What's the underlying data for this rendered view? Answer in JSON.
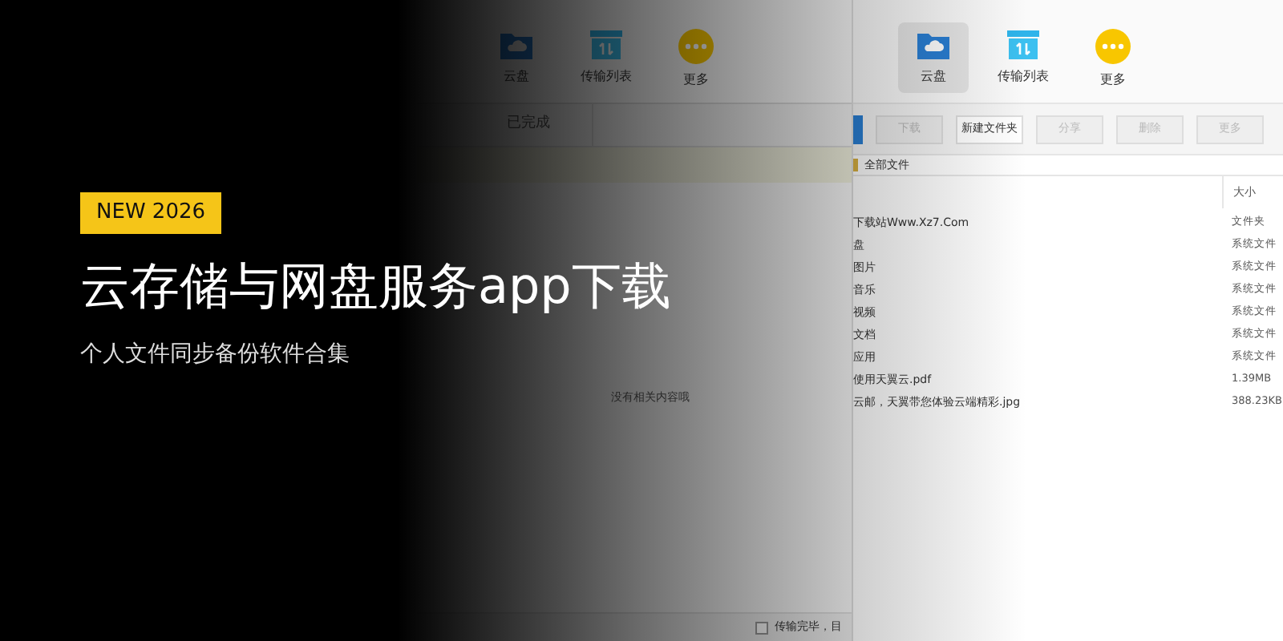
{
  "banner": {
    "badge": "NEW 2026",
    "title": "云存储与网盘服务app下载",
    "subtitle": "个人文件同步备份软件合集"
  },
  "left_window": {
    "nav": [
      {
        "label": "云盘",
        "kind": "cloud"
      },
      {
        "label": "传输列表",
        "kind": "transfer"
      },
      {
        "label": "更多",
        "kind": "more"
      }
    ],
    "tab": "已完成",
    "empty_message": "没有相关内容哦",
    "status": {
      "checked": false,
      "label": "传输完毕，目"
    }
  },
  "right_window": {
    "nav": [
      {
        "label": "云盘",
        "kind": "cloud",
        "selected": true
      },
      {
        "label": "传输列表",
        "kind": "transfer",
        "selected": false
      },
      {
        "label": "更多",
        "kind": "more",
        "selected": false
      }
    ],
    "buttons": [
      {
        "label": "下载",
        "disabled": true
      },
      {
        "label": "新建文件夹",
        "disabled": false
      },
      {
        "label": "分享",
        "disabled": true
      },
      {
        "label": "删除",
        "disabled": true
      },
      {
        "label": "更多",
        "disabled": true
      }
    ],
    "breadcrumb": "全部文件",
    "columns": [
      "大小"
    ],
    "rows": [
      {
        "name": "下载站Www.Xz7.Com",
        "size": "文件夹"
      },
      {
        "name": "盘",
        "size": "系统文件"
      },
      {
        "name": "图片",
        "size": "系统文件"
      },
      {
        "name": "音乐",
        "size": "系统文件"
      },
      {
        "name": "视频",
        "size": "系统文件"
      },
      {
        "name": "文档",
        "size": "系统文件"
      },
      {
        "name": "应用",
        "size": "系统文件"
      },
      {
        "name": "使用天翼云.pdf",
        "size": "1.39MB"
      },
      {
        "name": "云邮，天翼带您体验云端精彩.jpg",
        "size": "388.23KB"
      }
    ]
  }
}
